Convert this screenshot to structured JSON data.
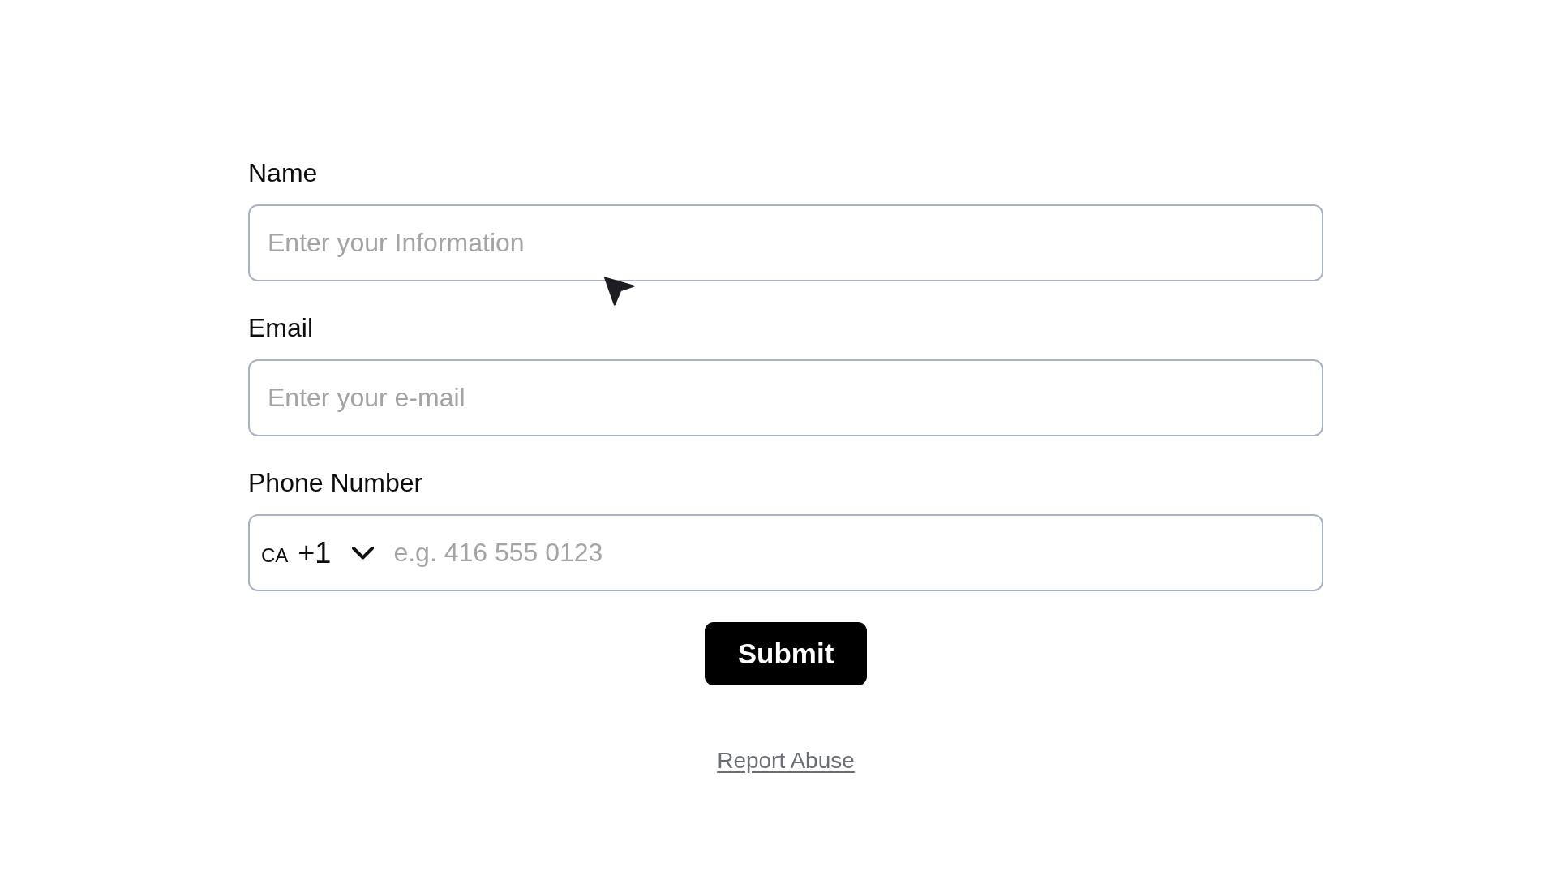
{
  "form": {
    "fields": [
      {
        "kind": "text",
        "label": "Name",
        "placeholder": "Enter your Information"
      },
      {
        "kind": "text",
        "label": "Email",
        "placeholder": "Enter your e-mail"
      },
      {
        "kind": "phone",
        "label": "Phone Number",
        "country": "CA",
        "dial_code": "+1",
        "placeholder": "e.g. 416 555 0123"
      }
    ],
    "submit": "Submit",
    "link": "Report Abuse"
  }
}
